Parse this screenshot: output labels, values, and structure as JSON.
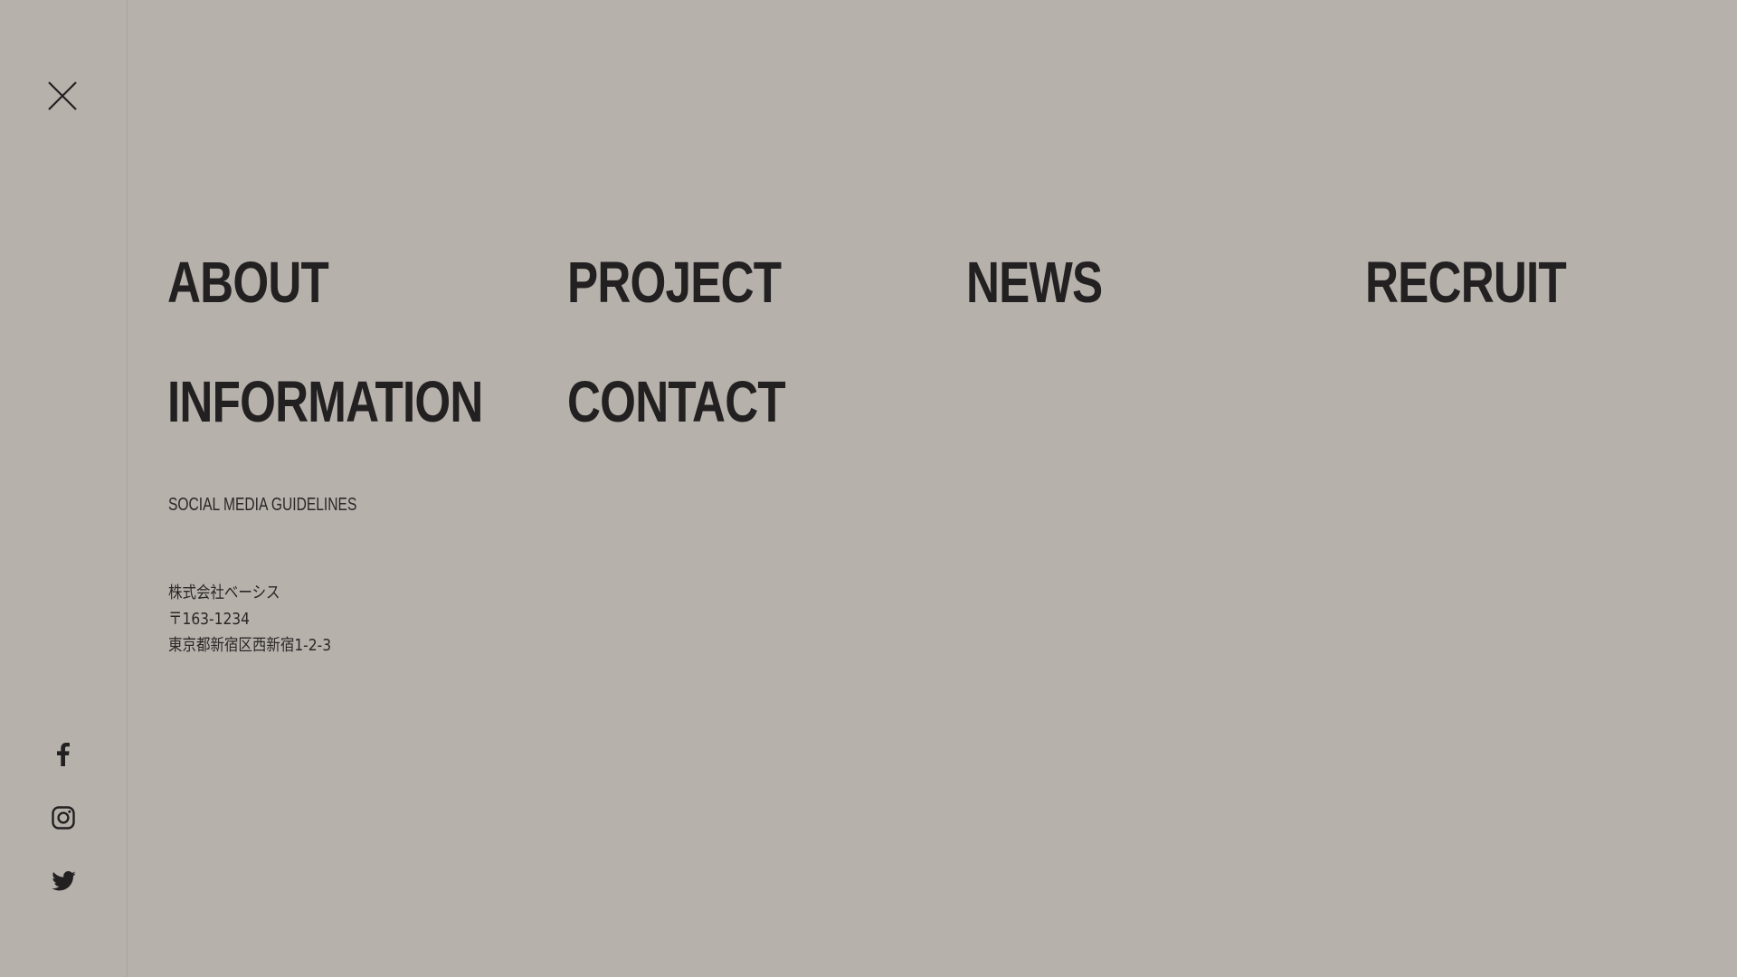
{
  "sidebar": {
    "close_icon": "close-icon",
    "social": [
      {
        "name": "facebook",
        "icon": "facebook-icon"
      },
      {
        "name": "instagram",
        "icon": "instagram-icon"
      },
      {
        "name": "twitter",
        "icon": "twitter-icon"
      }
    ]
  },
  "menu": {
    "items": [
      {
        "label": "ABOUT"
      },
      {
        "label": "PROJECT"
      },
      {
        "label": "NEWS"
      },
      {
        "label": "RECRUIT"
      },
      {
        "label": "INFORMATION"
      },
      {
        "label": "CONTACT"
      }
    ],
    "guidelines_label": "SOCIAL MEDIA GUIDELINES"
  },
  "company": {
    "name": "株式会社ベーシス",
    "postal": "〒163-1234",
    "address": "東京都新宿区西新宿1-2-3"
  },
  "colors": {
    "background": "#b7b1ac",
    "text": "#222020",
    "divider": "#a9a39e"
  }
}
